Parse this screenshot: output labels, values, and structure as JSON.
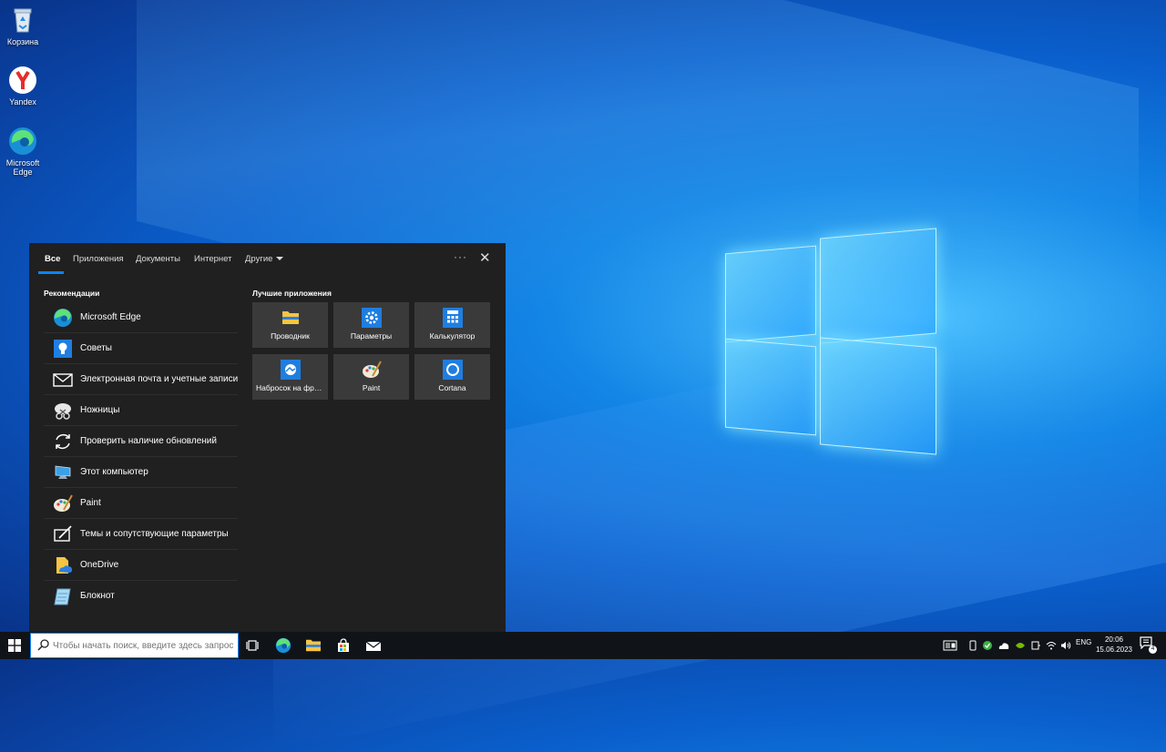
{
  "desktop": {
    "icons": [
      {
        "label": "Корзина",
        "icon": "recycle-bin-icon"
      },
      {
        "label": "Yandex",
        "icon": "yandex-icon"
      },
      {
        "label": "Microsoft Edge",
        "icon": "edge-icon"
      }
    ]
  },
  "search_panel": {
    "tabs": [
      {
        "label": "Все",
        "active": true
      },
      {
        "label": "Приложения"
      },
      {
        "label": "Документы"
      },
      {
        "label": "Интернет"
      },
      {
        "label": "Другие"
      }
    ],
    "more_label": "···",
    "close_label": "✕",
    "recommendations": {
      "title": "Рекомендации",
      "items": [
        {
          "label": "Microsoft Edge",
          "icon": "edge-icon"
        },
        {
          "label": "Советы",
          "icon": "tips-icon"
        },
        {
          "label": "Электронная почта и учетные записи",
          "icon": "mail-icon"
        },
        {
          "label": "Ножницы",
          "icon": "snipping-tool-icon"
        },
        {
          "label": "Проверить наличие обновлений",
          "icon": "update-icon"
        },
        {
          "label": "Этот компьютер",
          "icon": "computer-icon"
        },
        {
          "label": "Paint",
          "icon": "paint-icon"
        },
        {
          "label": "Темы и сопутствующие параметры",
          "icon": "themes-icon"
        },
        {
          "label": "OneDrive",
          "icon": "onedrive-icon"
        },
        {
          "label": "Блокнот",
          "icon": "notepad-icon"
        }
      ]
    },
    "top_apps": {
      "title": "Лучшие приложения",
      "tiles": [
        {
          "label": "Проводник",
          "icon": "file-explorer-icon"
        },
        {
          "label": "Параметры",
          "icon": "settings-icon"
        },
        {
          "label": "Калькулятор",
          "icon": "calculator-icon"
        },
        {
          "label": "Набросок на фрагменте экрана",
          "icon": "snip-sketch-icon"
        },
        {
          "label": "Paint",
          "icon": "paint-icon"
        },
        {
          "label": "Cortana",
          "icon": "cortana-icon"
        }
      ]
    }
  },
  "taskbar": {
    "search_placeholder": "Чтобы начать поиск, введите здесь запрос",
    "language": "ENG",
    "time": "20:06",
    "date": "15.06.2023",
    "notification_count": "4"
  }
}
